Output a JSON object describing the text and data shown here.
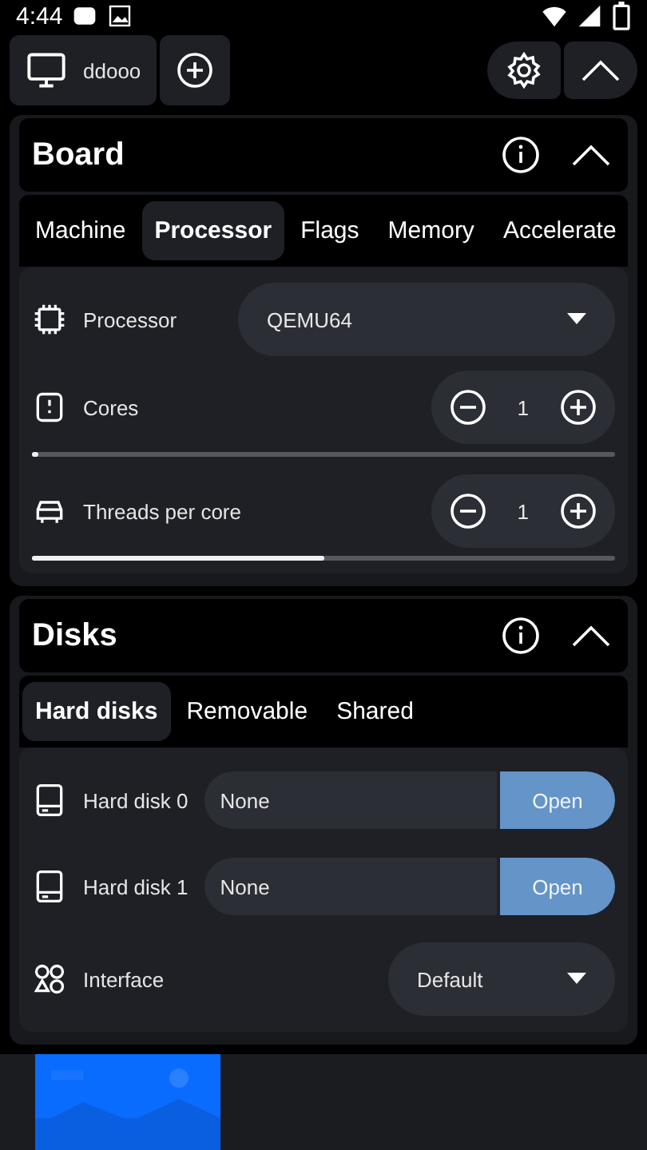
{
  "status_bar": {
    "time": "4:44"
  },
  "toolbar": {
    "machine_name": "ddooo"
  },
  "board": {
    "title": "Board",
    "expanded": true,
    "tabs": [
      {
        "label": "Machine",
        "selected": false
      },
      {
        "label": "Processor",
        "selected": true
      },
      {
        "label": "Flags",
        "selected": false
      },
      {
        "label": "Memory",
        "selected": false
      },
      {
        "label": "Accelerate",
        "selected": false
      }
    ],
    "processor": {
      "label": "Processor",
      "value": "QEMU64"
    },
    "steppers": [
      {
        "kind": "cores",
        "label": "Cores",
        "value": "1",
        "level": 0.01
      },
      {
        "kind": "threads",
        "label": "Threads per core",
        "value": "1",
        "level": 0.5
      }
    ]
  },
  "disks": {
    "title": "Disks",
    "expanded": true,
    "tabs": [
      {
        "label": "Hard disks",
        "selected": true
      },
      {
        "label": "Removable",
        "selected": false
      },
      {
        "label": "Shared",
        "selected": false
      }
    ],
    "hard_disks": [
      {
        "label": "Hard disk 0",
        "value": "None",
        "button": "Open"
      },
      {
        "label": "Hard disk 1",
        "value": "None",
        "button": "Open"
      }
    ],
    "interface": {
      "label": "Interface",
      "value": "Default"
    }
  }
}
